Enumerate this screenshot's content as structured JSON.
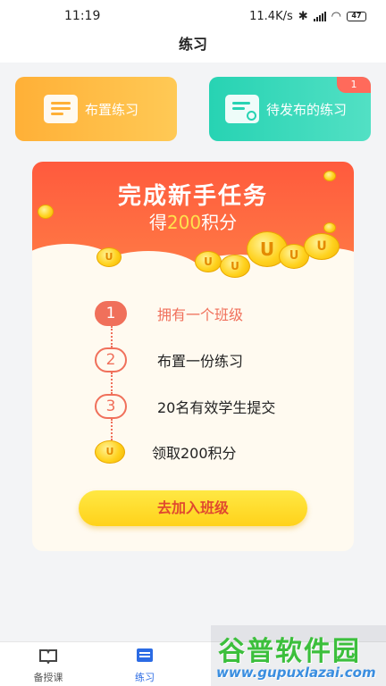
{
  "status": {
    "time": "11:19",
    "network_speed": "11.4K/s",
    "battery": "47"
  },
  "header": {
    "title": "练习"
  },
  "actions": {
    "assign": {
      "label": "布置练习",
      "icon": "book-check-icon",
      "color": "#ffb037"
    },
    "pending": {
      "label": "待发布的练习",
      "icon": "clock-document-icon",
      "badge": "1",
      "color": "#27d3b3"
    }
  },
  "task": {
    "title": "完成新手任务",
    "reward_prefix": "得",
    "reward_points": "200",
    "reward_suffix": "积分",
    "steps": [
      {
        "num": "1",
        "label": "拥有一个班级",
        "active": true
      },
      {
        "num": "2",
        "label": "布置一份练习",
        "active": false
      },
      {
        "num": "3",
        "label": "20名有效学生提交",
        "active": false
      }
    ],
    "final_step": {
      "label": "领取200积分",
      "icon": "coin-icon"
    },
    "join_button": "去加入班级",
    "banner_color": "#ff5a3d"
  },
  "bottom_nav": {
    "items": [
      {
        "label": "备授课",
        "icon": "book-open-icon"
      },
      {
        "label": "练习",
        "icon": "practice-icon"
      }
    ]
  },
  "watermark": {
    "title": "谷普软件园",
    "url": "www.gupuxlazai.com"
  }
}
